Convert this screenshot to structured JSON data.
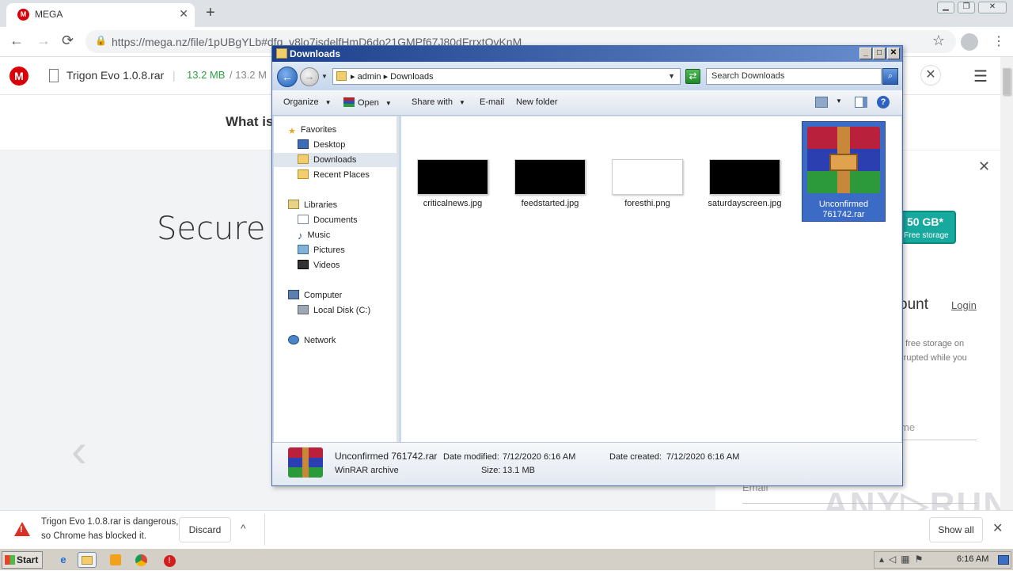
{
  "browser": {
    "tab_title": "MEGA",
    "tab_favicon": "M",
    "url": "https://mega.nz/file/1pUBgYLb#dfg_v8lo7isdelfHmD6do21GMPf67J80dFrrxtOvKnM",
    "new_tab_symbol": "+",
    "close_symbol": "✕",
    "back_symbol": "←",
    "forward_symbol": "→",
    "reload_symbol": "⟳",
    "lock_symbol": "🔒",
    "star_symbol": "☆",
    "menu_symbol": "⋮"
  },
  "mega": {
    "logo_letter": "M",
    "file_name": "Trigon Evo 1.0.8.rar",
    "separator": "|",
    "size_downloaded": "13.2 MB",
    "size_total": "/ 13.2 M",
    "close_symbol": "✕",
    "menu_symbol": "☰",
    "what_is": "What is",
    "hero_title": "Secure",
    "prev_arrow": "‹",
    "storage_big": "50 GB*",
    "storage_small": "Free storage",
    "account_title": "ount",
    "login_link": "Login",
    "promo_line1": "f free storage on",
    "promo_line2": "rrupted while you",
    "name_placeholder": "me",
    "email_placeholder": "Email",
    "watermark": "ANY▷RUN"
  },
  "download_shelf": {
    "warning_line1": "Trigon Evo 1.0.8.rar is dangerous,",
    "warning_line2": "so Chrome has blocked it.",
    "discard_label": "Discard",
    "chevron": "^",
    "show_all_label": "Show all",
    "close_symbol": "✕"
  },
  "explorer": {
    "title": "Downloads",
    "title_buttons": [
      "_",
      "□",
      "✕"
    ],
    "back_symbol": "←",
    "forward_symbol": "→",
    "breadcrumb": "▸  admin  ▸  Downloads",
    "search_placeholder": "Search Downloads",
    "commands": {
      "organize": "Organize",
      "open": "Open",
      "share_with": "Share with",
      "email": "E-mail",
      "new_folder": "New folder",
      "help": "?"
    },
    "nav": {
      "favorites": "Favorites",
      "desktop": "Desktop",
      "downloads": "Downloads",
      "recent_places": "Recent Places",
      "libraries": "Libraries",
      "documents": "Documents",
      "music": "Music",
      "pictures": "Pictures",
      "videos": "Videos",
      "computer": "Computer",
      "local_disk": "Local Disk (C:)",
      "network": "Network"
    },
    "files": [
      {
        "name": "criticalnews.jpg"
      },
      {
        "name": "feedstarted.jpg"
      },
      {
        "name": "foresthi.png"
      },
      {
        "name": "saturdayscreen.jpg"
      },
      {
        "name": "Unconfirmed 761742.rar",
        "line1": "Unconfirmed",
        "line2": "761742.rar"
      }
    ],
    "details": {
      "name": "Unconfirmed 761742.rar",
      "type": "WinRAR archive",
      "date_modified_label": "Date modified:",
      "date_modified": "7/12/2020 6:16 AM",
      "date_created_label": "Date created:",
      "date_created": "7/12/2020 6:16 AM",
      "size_label": "Size:",
      "size": "13.1 MB"
    }
  },
  "taskbar": {
    "start_label": "Start",
    "clock": "6:16 AM"
  }
}
